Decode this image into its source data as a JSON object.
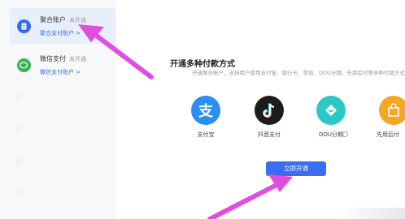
{
  "sidebar": {
    "accounts": [
      {
        "name": "聚合账户",
        "status": "未开通",
        "link": "聚合支付账户 >",
        "icon": "document-icon",
        "color": "#2f6cf0"
      },
      {
        "name": "微信支付",
        "status": "未开通",
        "link": "微信支付账户 >",
        "icon": "wechat-icon",
        "color": "#35b54d"
      }
    ]
  },
  "main": {
    "title": "开通多种付款方式",
    "subtitle": "开通聚合账户，支持用户使用支付宝、银行卡、零钱、DOU分期、先用后付等多种付款方式",
    "methods": [
      {
        "label": "支付宝",
        "icon": "alipay-icon",
        "color": "#2c8ef0"
      },
      {
        "label": "抖音支付",
        "icon": "douyin-icon",
        "color": "#1c1c1c"
      },
      {
        "label": "DOU分期",
        "icon": "dou-installment-icon",
        "color": "#2bc8c4"
      },
      {
        "label": "先用后付",
        "icon": "pay-later-icon",
        "color": "#f5a623"
      }
    ],
    "open_button": "立即开通"
  },
  "colors": {
    "accent": "#3b6df0",
    "arrow": "#e04ee0"
  }
}
